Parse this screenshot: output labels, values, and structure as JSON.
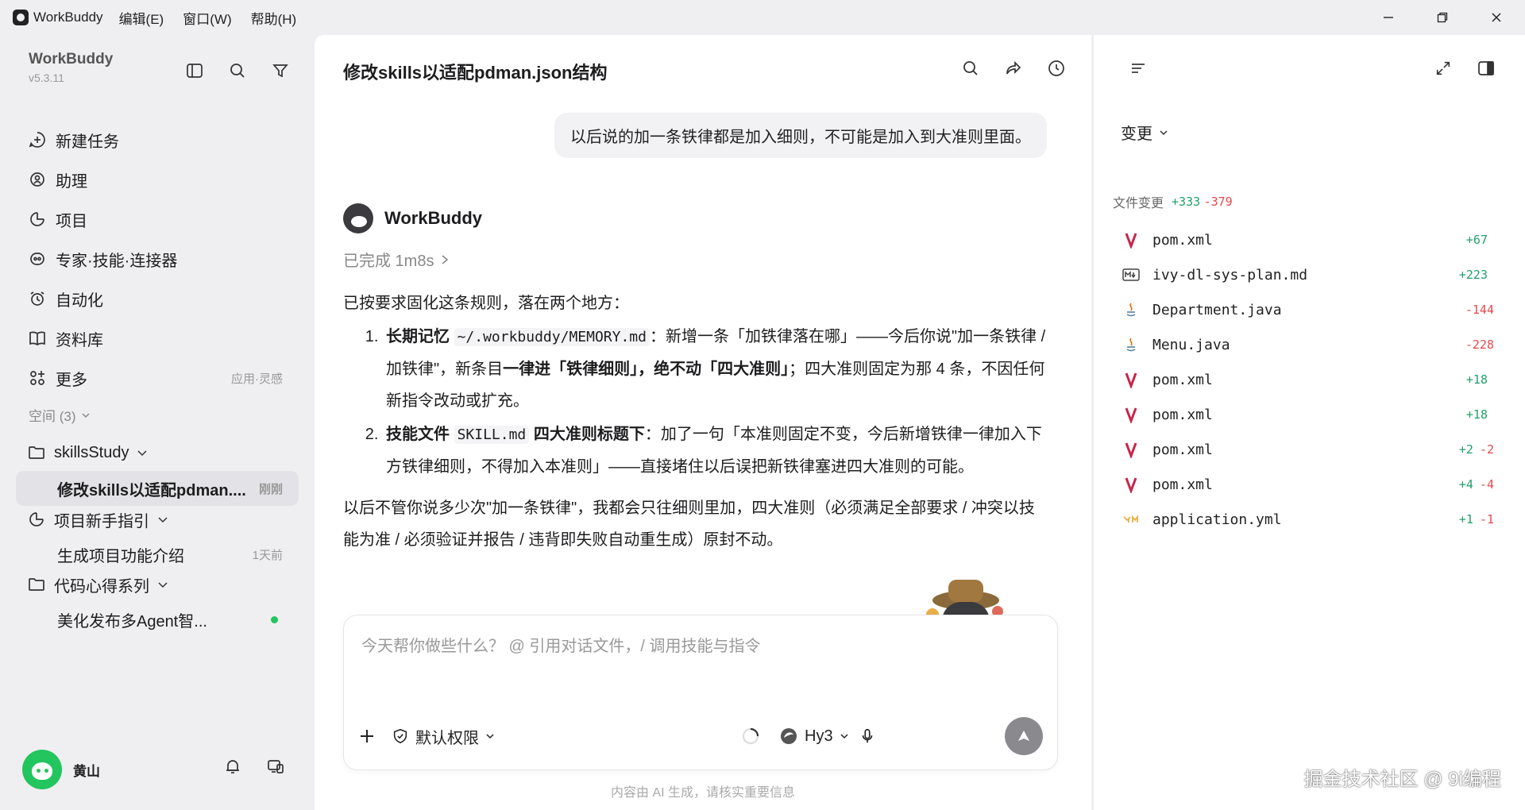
{
  "titlebar": {
    "app_name": "WorkBuddy",
    "menus": [
      "编辑(E)",
      "窗口(W)",
      "帮助(H)"
    ]
  },
  "sidebar": {
    "brand": "WorkBuddy",
    "version": "v5.3.11",
    "nav": [
      {
        "label": "新建任务",
        "icon": "plus-circle-icon"
      },
      {
        "label": "助理",
        "icon": "assistant-icon"
      },
      {
        "label": "项目",
        "icon": "project-icon"
      },
      {
        "label": "专家·技能·连接器",
        "icon": "expert-icon"
      },
      {
        "label": "自动化",
        "icon": "alarm-icon"
      },
      {
        "label": "资料库",
        "icon": "book-icon"
      },
      {
        "label": "更多",
        "icon": "grid-icon",
        "hint": "应用·灵感"
      }
    ],
    "spaces_header": "空间 (3)",
    "folders": [
      {
        "name": "skillsStudy"
      },
      {
        "name": "项目新手指引"
      },
      {
        "name": "代码心得系列"
      }
    ],
    "tasks": [
      {
        "title": "修改skills以适配pdman....",
        "time": "刚刚"
      },
      {
        "title": "生成项目功能介绍",
        "time": "1天前"
      },
      {
        "title": "美化发布多Agent智..."
      }
    ],
    "user_name": "黄山"
  },
  "chat": {
    "title": "修改skills以适配pdman.json结构",
    "user_message": "以后说的加一条铁律都是加入细则，不可能是加入到大准则里面。",
    "bot_name": "WorkBuddy",
    "status": "已完成 1m8s",
    "intro": "已按要求固化这条规则，落在两个地方：",
    "item1": {
      "b1": "长期记忆",
      "code": "~/.workbuddy/MEMORY.md",
      "t1": "：新增一条「加铁律落在哪」——今后你说\"加一条铁律 / 加铁律\"，新条目",
      "b2": "一律进「铁律细则」，绝不动「四大准则」",
      "t2": "；四大准则固定为那 4 条，不因任何新指令改动或扩充。"
    },
    "item2": {
      "b1": "技能文件",
      "code": "SKILL.md",
      "b2": "四大准则标题下",
      "t1": "：加了一句「本准则固定不变，今后新增铁律一律加入下方铁律细则，不得加入本准则」——直接堵住以后误把新铁律塞进四大准则的可能。"
    },
    "closing": "以后不管你说多少次\"加一条铁律\"，我都会只往细则里加，四大准则（必须满足全部要求 / 冲突以技能为准 / 必须验证并报告 / 违背即失败自动重生成）原封不动。",
    "input_placeholder": "今天帮你做些什么？ @ 引用对话文件，/ 调用技能与指令",
    "permission_label": "默认权限",
    "model_label": "Hy3",
    "footer": "内容由 AI 生成，请核实重要信息"
  },
  "changes": {
    "dropdown": "变更",
    "summary_label": "文件变更",
    "summary_add": "+333",
    "summary_del": "-379",
    "files": [
      {
        "name": "pom.xml",
        "icon": "maven-icon",
        "add": "+67",
        "del": ""
      },
      {
        "name": "ivy-dl-sys-plan.md",
        "icon": "markdown-icon",
        "add": "+223",
        "del": ""
      },
      {
        "name": "Department.java",
        "icon": "java-icon",
        "add": "",
        "del": "-144"
      },
      {
        "name": "Menu.java",
        "icon": "java-icon",
        "add": "",
        "del": "-228"
      },
      {
        "name": "pom.xml",
        "icon": "maven-icon",
        "add": "+18",
        "del": ""
      },
      {
        "name": "pom.xml",
        "icon": "maven-icon",
        "add": "+18",
        "del": ""
      },
      {
        "name": "pom.xml",
        "icon": "maven-icon",
        "add": "+2",
        "del": "-2"
      },
      {
        "name": "pom.xml",
        "icon": "maven-icon",
        "add": "+4",
        "del": "-4"
      },
      {
        "name": "application.yml",
        "icon": "yaml-icon",
        "add": "+1",
        "del": "-1"
      }
    ]
  },
  "watermark": "掘金技术社区 @ 9i编程",
  "colors": {
    "added": "#22a06b",
    "deleted": "#e5484d",
    "online": "#22c55e"
  }
}
